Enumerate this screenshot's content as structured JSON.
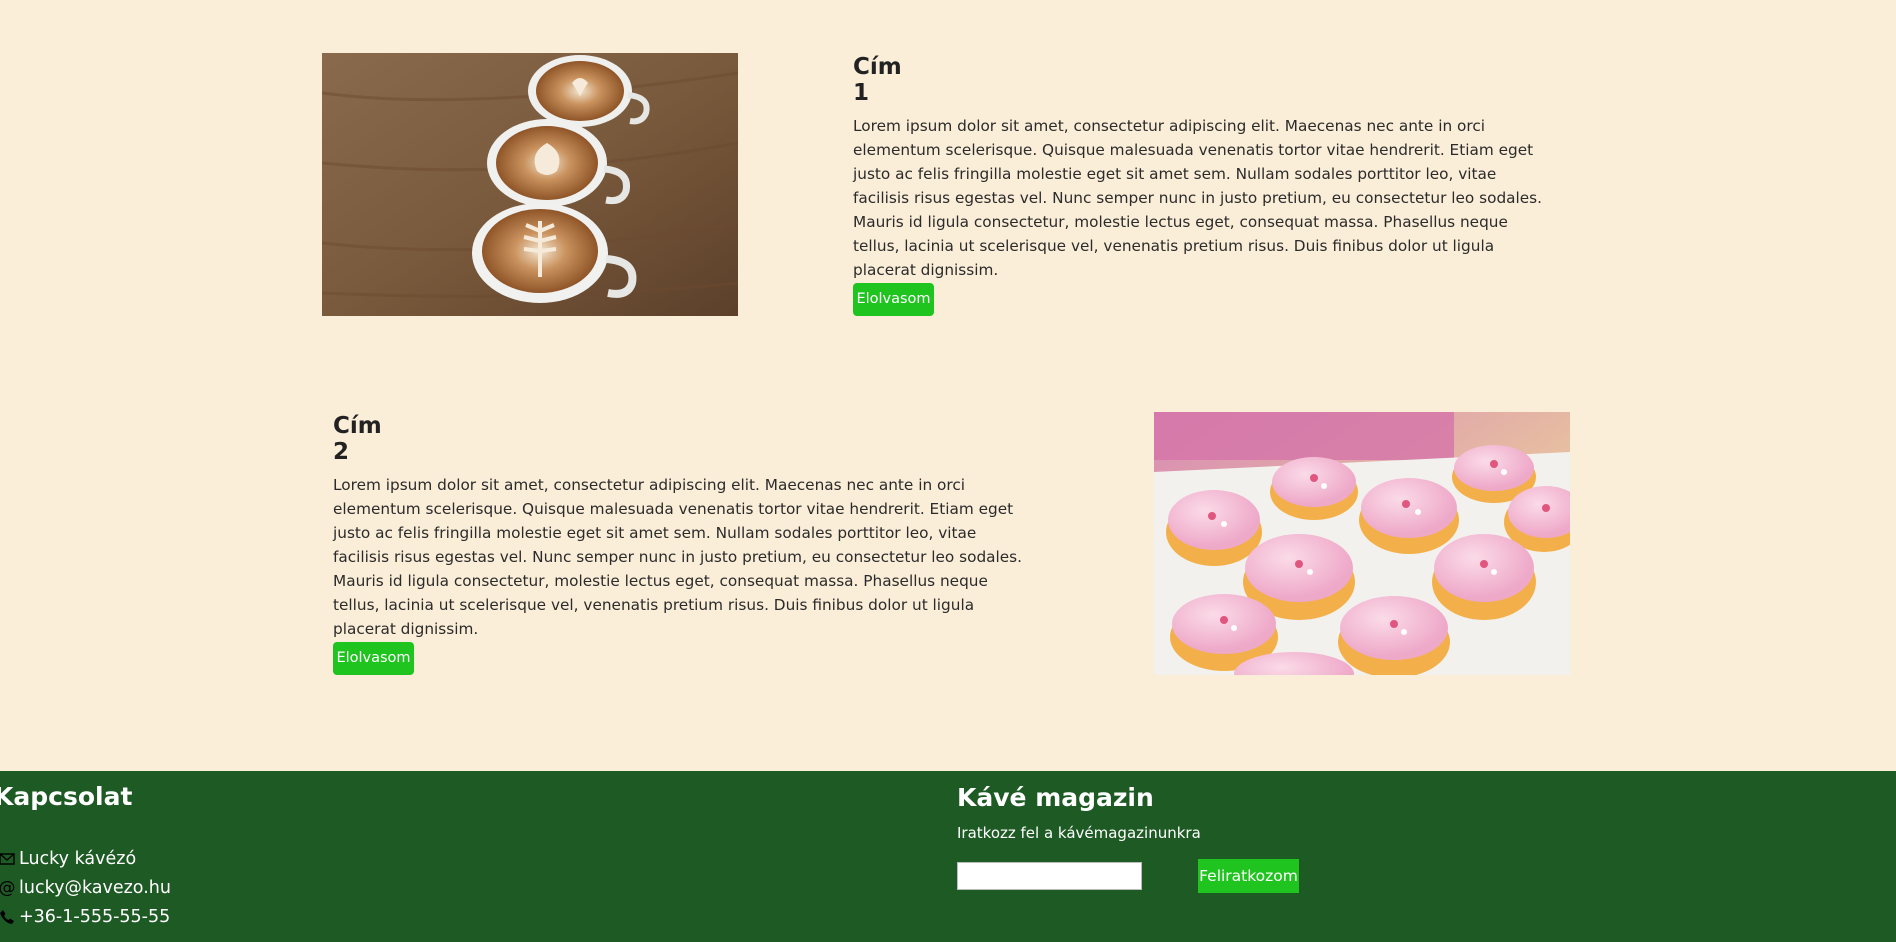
{
  "articles": [
    {
      "title": "Cím 1",
      "body": "Lorem ipsum dolor sit amet, consectetur adipiscing elit. Maecenas nec ante in orci elementum scelerisque. Quisque malesuada venenatis tortor vitae hendrerit. Etiam eget justo ac felis fringilla molestie eget sit amet sem. Nullam sodales porttitor leo, vitae facilisis risus egestas vel. Nunc semper nunc in justo pretium, eu consectetur leo sodales. Mauris id ligula consectetur, molestie lectus eget, consequat massa. Phasellus neque tellus, lacinia ut scelerisque vel, venenatis pretium risus. Duis finibus dolor ut ligula placerat dignissim.",
      "button": "Elolvasom",
      "image": "coffee-cups-latte-art"
    },
    {
      "title": "Cím 2",
      "body": "Lorem ipsum dolor sit amet, consectetur adipiscing elit. Maecenas nec ante in orci elementum scelerisque. Quisque malesuada venenatis tortor vitae hendrerit. Etiam eget justo ac felis fringilla molestie eget sit amet sem. Nullam sodales porttitor leo, vitae facilisis risus egestas vel. Nunc semper nunc in justo pretium, eu consectetur leo sodales. Mauris id ligula consectetur, molestie lectus eget, consequat massa. Phasellus neque tellus, lacinia ut scelerisque vel, venenatis pretium risus. Duis finibus dolor ut ligula placerat dignissim.",
      "button": "Elolvasom",
      "image": "pink-iced-cupcakes"
    }
  ],
  "footer": {
    "contact": {
      "title": "Kapcsolat",
      "name": "Lucky kávézó",
      "email": "lucky@kavezo.hu",
      "phone": "+36-1-555-55-55",
      "icons": [
        "envelope-icon",
        "at-icon",
        "phone-icon"
      ]
    },
    "magazine": {
      "title": "Kávé magazin",
      "subtitle": "Iratkozz fel a kávémagazinunkra",
      "input_value": "",
      "button": "Feliratkozom"
    }
  },
  "colors": {
    "background": "#fbeed9",
    "footer": "#1e5a24",
    "accent": "#1fc41f"
  }
}
